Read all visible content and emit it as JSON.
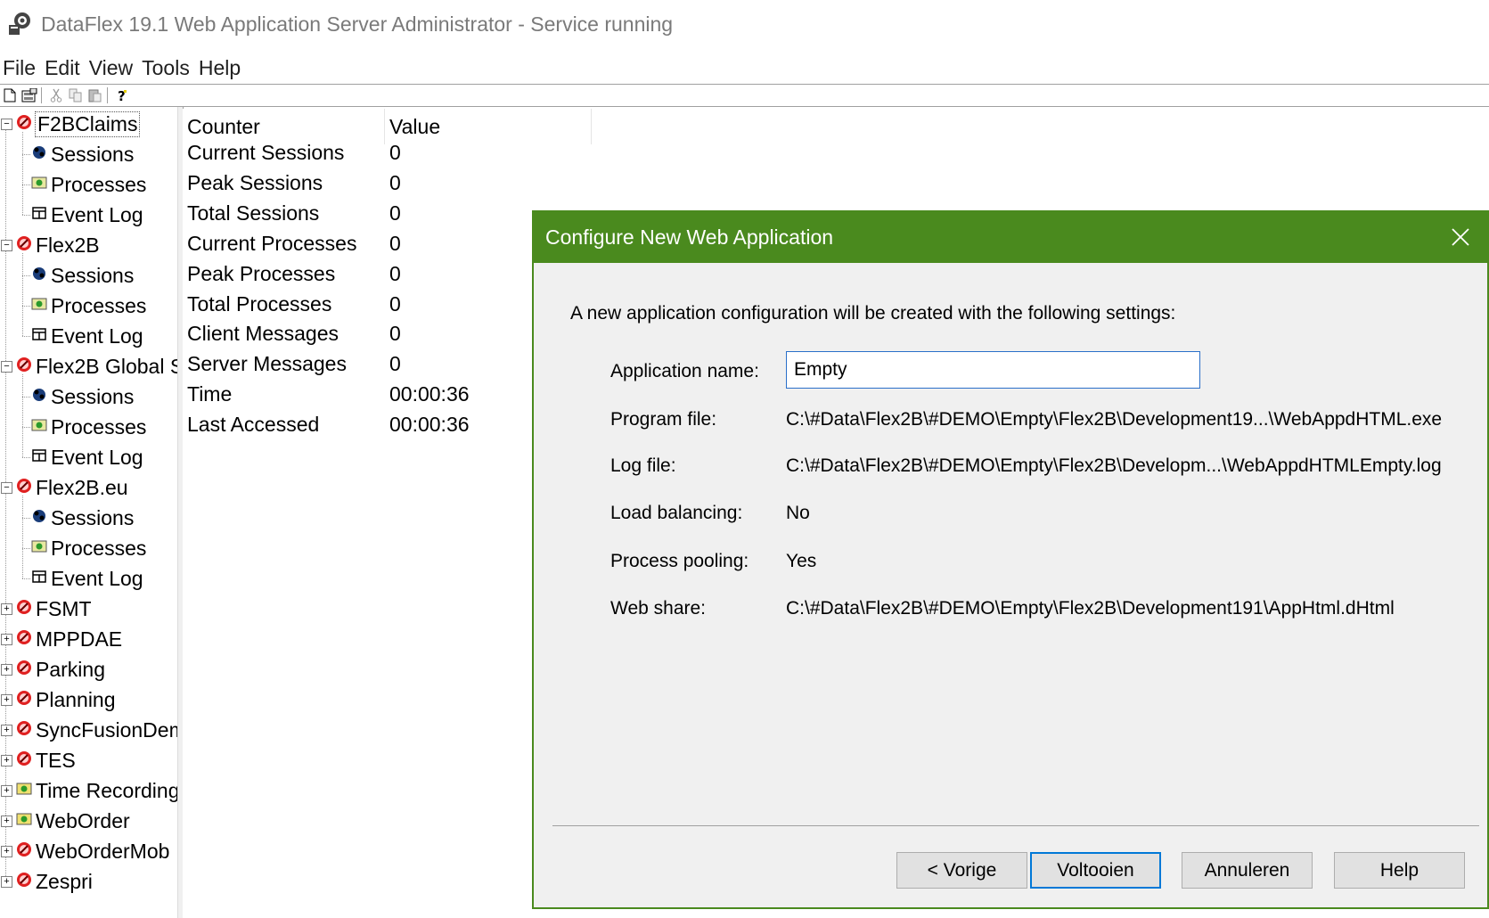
{
  "window": {
    "title": "DataFlex 19.1 Web Application Server Administrator - Service running"
  },
  "menu": [
    "File",
    "Edit",
    "View",
    "Tools",
    "Help"
  ],
  "toolbar": {
    "buttons": [
      "new-icon",
      "properties-icon",
      "cut-icon",
      "copy-icon",
      "paste-icon",
      "help-icon"
    ]
  },
  "tree": {
    "items": [
      {
        "label": "F2BClaims",
        "level": 0,
        "expanded": true,
        "selected": true
      },
      {
        "label": "Sessions",
        "level": 1,
        "icon": "sessions-icon"
      },
      {
        "label": "Processes",
        "level": 1,
        "icon": "processes-icon"
      },
      {
        "label": "Event Log",
        "level": 1,
        "icon": "event-log-icon"
      },
      {
        "label": "Flex2B",
        "level": 0,
        "expanded": true
      },
      {
        "label": "Sessions",
        "level": 1,
        "icon": "sessions-icon"
      },
      {
        "label": "Processes",
        "level": 1,
        "icon": "processes-icon"
      },
      {
        "label": "Event Log",
        "level": 1,
        "icon": "event-log-icon"
      },
      {
        "label": "Flex2B Global S",
        "level": 0,
        "expanded": true
      },
      {
        "label": "Sessions",
        "level": 1,
        "icon": "sessions-icon"
      },
      {
        "label": "Processes",
        "level": 1,
        "icon": "processes-icon"
      },
      {
        "label": "Event Log",
        "level": 1,
        "icon": "event-log-icon"
      },
      {
        "label": "Flex2B.eu",
        "level": 0,
        "expanded": true
      },
      {
        "label": "Sessions",
        "level": 1,
        "icon": "sessions-icon"
      },
      {
        "label": "Processes",
        "level": 1,
        "icon": "processes-icon"
      },
      {
        "label": "Event Log",
        "level": 1,
        "icon": "event-log-icon"
      },
      {
        "label": "FSMT",
        "level": 0,
        "expanded": false
      },
      {
        "label": "MPPDAE",
        "level": 0,
        "expanded": false
      },
      {
        "label": "Parking",
        "level": 0,
        "expanded": false
      },
      {
        "label": "Planning",
        "level": 0,
        "expanded": false
      },
      {
        "label": "SyncFusionDem",
        "level": 0,
        "expanded": false
      },
      {
        "label": "TES",
        "level": 0,
        "expanded": false
      },
      {
        "label": "Time Recording",
        "level": 0,
        "expanded": false,
        "variant": "running"
      },
      {
        "label": "WebOrder",
        "level": 0,
        "expanded": false,
        "variant": "running"
      },
      {
        "label": "WebOrderMob",
        "level": 0,
        "expanded": false
      },
      {
        "label": "Zespri",
        "level": 0,
        "expanded": false
      }
    ]
  },
  "counters": {
    "headers": {
      "counter": "Counter",
      "value": "Value"
    },
    "rows": [
      {
        "counter": "Current Sessions",
        "value": "0"
      },
      {
        "counter": "Peak Sessions",
        "value": "0"
      },
      {
        "counter": "Total Sessions",
        "value": "0"
      },
      {
        "counter": "Current Processes",
        "value": "0"
      },
      {
        "counter": "Peak Processes",
        "value": "0"
      },
      {
        "counter": "Total Processes",
        "value": "0"
      },
      {
        "counter": "Client Messages",
        "value": "0"
      },
      {
        "counter": "Server Messages",
        "value": "0"
      },
      {
        "counter": "Time",
        "value": "00:00:36"
      },
      {
        "counter": "Last Accessed",
        "value": "00:00:36"
      }
    ]
  },
  "dialog": {
    "title": "Configure New Web Application",
    "intro": "A new application configuration will be created with the following settings:",
    "app_name_label": "Application name:",
    "app_name_value": "Empty",
    "fields": [
      {
        "label": "Program file:",
        "value": "C:\\#Data\\Flex2B\\#DEMO\\Empty\\Flex2B\\Development19...\\WebAppdHTML.exe"
      },
      {
        "label": "Log file:",
        "value": "C:\\#Data\\Flex2B\\#DEMO\\Empty\\Flex2B\\Developm...\\WebAppdHTMLEmpty.log"
      },
      {
        "label": "Load balancing:",
        "value": "No"
      },
      {
        "label": "Process pooling:",
        "value": "Yes"
      },
      {
        "label": "Web share:",
        "value": "C:\\#Data\\Flex2B\\#DEMO\\Empty\\Flex2B\\Development191\\AppHtml.dHtml"
      }
    ],
    "buttons": {
      "back": "< Vorige",
      "finish": "Voltooien",
      "cancel": "Annuleren",
      "help": "Help"
    }
  },
  "colors": {
    "dialog_accent": "#4a8a1e",
    "focus_border": "#0078d7",
    "app_icon_stopped": "#e02020"
  }
}
